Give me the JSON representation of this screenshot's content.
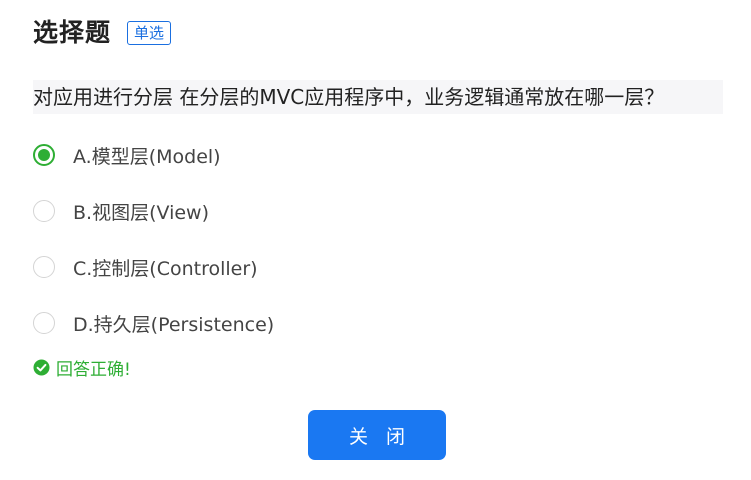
{
  "header": {
    "title": "选择题",
    "type_badge": "单选"
  },
  "question": {
    "text": "对应用进行分层 在分层的MVC应用程序中，业务逻辑通常放在哪一层？"
  },
  "options": [
    {
      "label": "A.模型层(Model)",
      "selected": true
    },
    {
      "label": "B.视图层(View)",
      "selected": false
    },
    {
      "label": "C.控制层(Controller)",
      "selected": false
    },
    {
      "label": "D.持久层(Persistence)",
      "selected": false
    }
  ],
  "result": {
    "text": "回答正确!",
    "icon": "check-circle-icon"
  },
  "actions": {
    "close_label": "关 闭"
  },
  "colors": {
    "accent": "#1a78f2",
    "success": "#2eae34"
  }
}
